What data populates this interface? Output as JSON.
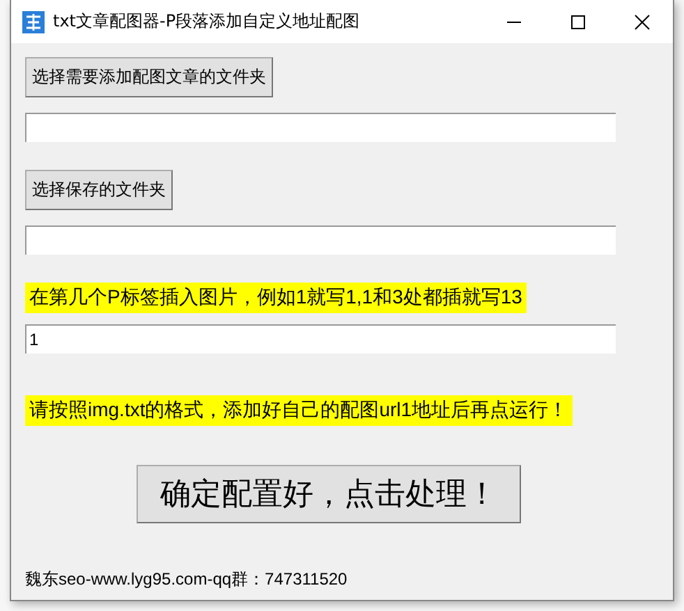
{
  "window": {
    "title": "txt文章配图器-P段落添加自定义地址配图"
  },
  "controls": [
    {
      "kind": "button",
      "label": "选择需要添加配图文章的文件夹"
    },
    {
      "kind": "field"
    },
    {
      "kind": "button",
      "label": "选择保存的文件夹"
    },
    {
      "kind": "field"
    },
    {
      "kind": "note",
      "text": "在第几个P标签插入图片，例如1就写1,1和3处都插就写13"
    },
    {
      "kind": "field",
      "value": "1"
    },
    {
      "kind": "note",
      "text": "请按照img.txt的格式，添加好自己的配图url1地址后再点运行！"
    },
    {
      "kind": "big-button",
      "label": "确定配置好，点击处理！"
    },
    {
      "kind": "footer",
      "text": "魏东seo-www.lyg95.com-qq群：747311520"
    }
  ]
}
